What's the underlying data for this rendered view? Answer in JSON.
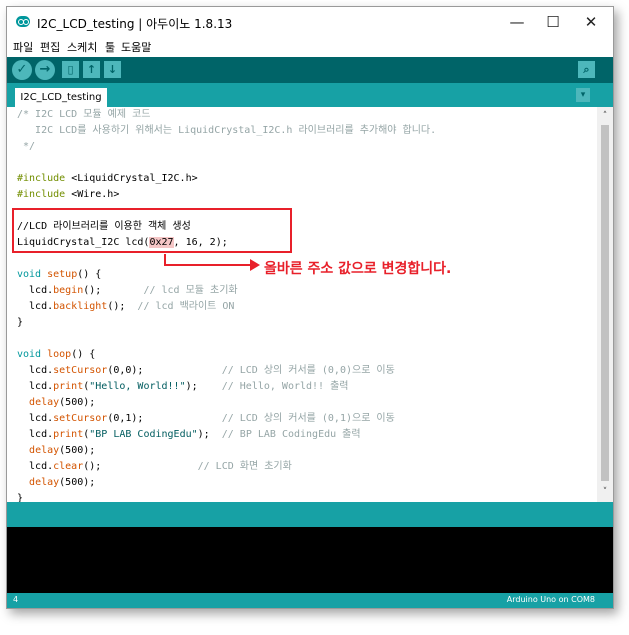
{
  "window": {
    "title": "I2C_LCD_testing | 아두이노 1.8.13",
    "min_icon": "—",
    "max_icon": "☐",
    "close_icon": "✕"
  },
  "menu": [
    "파일",
    "편집",
    "스케치",
    "툴",
    "도움말"
  ],
  "toolbar": {
    "verify": "✓",
    "upload": "→",
    "new": "▯",
    "open": "↑",
    "save": "↓",
    "serial": "⌕"
  },
  "tab": {
    "label": "I2C_LCD_testing",
    "menu_icon": "▾"
  },
  "code": {
    "l1": "/* I2C LCD 모듈 예제 코드",
    "l2": "   I2C LCD를 사용하기 위해서는 LiquidCrystal_I2C.h 라이브러리를 추가해야 합니다.",
    "l3": " */",
    "l5a": "#include ",
    "l5b": "<LiquidCrystal_I2C.h>",
    "l6a": "#include ",
    "l6b": "<Wire.h>",
    "l8": "//LCD 라이브러리를 이용한 객체 생성",
    "l9a": "LiquidCrystal_I2C lcd(",
    "l9b": "0x27",
    "l9c": ", 16, 2);",
    "l11a": "void",
    "l11b": " setup",
    "l11c": "() {",
    "l12a": "  lcd.",
    "l12b": "begin",
    "l12c": "();       ",
    "l12d": "// lcd 모듈 초기화",
    "l13a": "  lcd.",
    "l13b": "backlight",
    "l13c": "();  ",
    "l13d": "// lcd 백라이트 ON",
    "l14": "}",
    "l16a": "void",
    "l16b": " loop",
    "l16c": "() {",
    "l17a": "  lcd.",
    "l17b": "setCursor",
    "l17c": "(0,0);             ",
    "l17d": "// LCD 상의 커서를 (0,0)으로 이동",
    "l18a": "  lcd.",
    "l18b": "print",
    "l18c": "(",
    "l18d": "\"Hello, World!!\"",
    "l18e": ");    ",
    "l18f": "// Hello, World!! 출력",
    "l19a": "  ",
    "l19b": "delay",
    "l19c": "(500);",
    "l20a": "  lcd.",
    "l20b": "setCursor",
    "l20c": "(0,1);             ",
    "l20d": "// LCD 상의 커서를 (0,1)으로 이동",
    "l21a": "  lcd.",
    "l21b": "print",
    "l21c": "(",
    "l21d": "\"BP LAB CodingEdu\"",
    "l21e": ");  ",
    "l21f": "// BP LAB CodingEdu 출력",
    "l22a": "  ",
    "l22b": "delay",
    "l22c": "(500);",
    "l23a": "  lcd.",
    "l23b": "clear",
    "l23c": "();                ",
    "l23d": "// LCD 화면 초기화",
    "l24a": "  ",
    "l24b": "delay",
    "l24c": "(500);",
    "l25": "}"
  },
  "annotation": {
    "text": "올바른 주소 값으로 변경합니다."
  },
  "scroll": {
    "up": "˄",
    "down": "˅"
  },
  "status": {
    "line": "4",
    "board": "Arduino Uno on COM8"
  }
}
